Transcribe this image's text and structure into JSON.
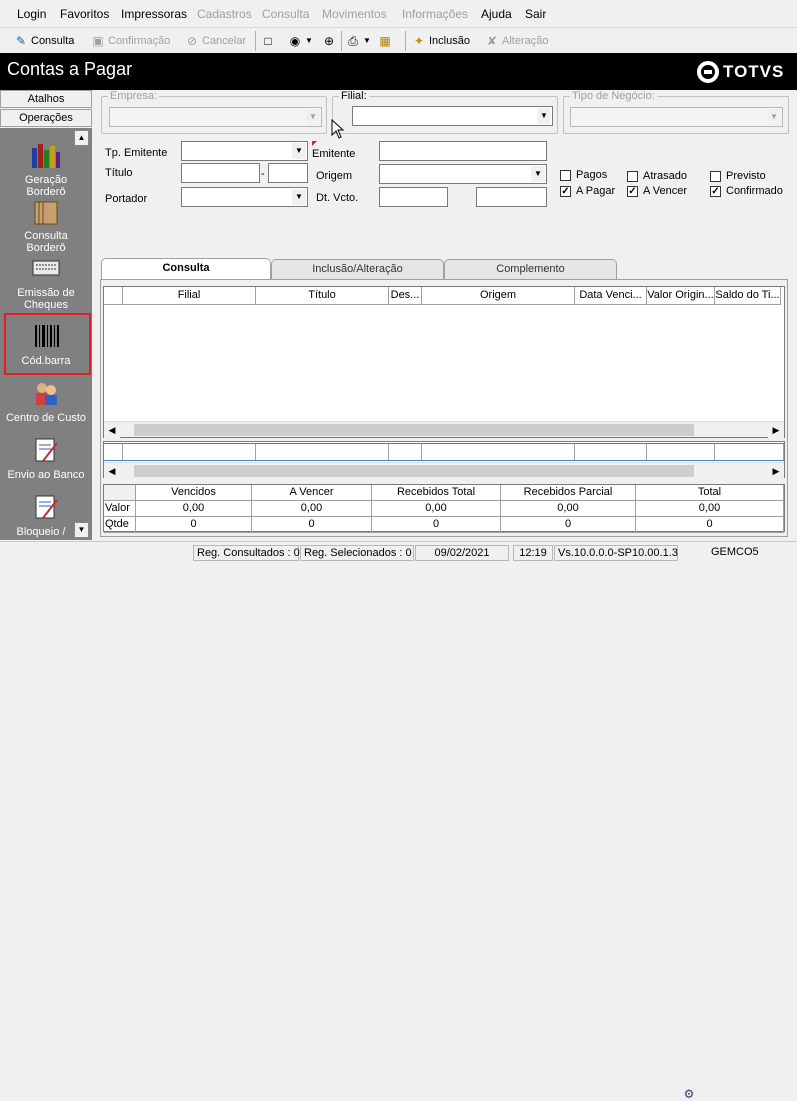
{
  "menu": [
    "Login",
    "Favoritos",
    "Impressoras",
    "Cadastros",
    "Consulta",
    "Movimentos",
    "Informações",
    "Ajuda",
    "Sair"
  ],
  "toolbar": {
    "consulta": "Consulta",
    "confirmacao": "Confirmação",
    "cancelar": "Cancelar",
    "inclusao": "Inclusão",
    "alteracao": "Alteração"
  },
  "title": "Contas a Pagar",
  "logo_text": "TOTVS",
  "sidebar": {
    "atalhos": "Atalhos",
    "operacoes": "Operações",
    "items": [
      "Geração Borderô",
      "Consulta Borderô",
      "Emissão de Cheques",
      "Cód.barra",
      "Centro de Custo",
      "Envio ao Banco",
      "Bloqueio /"
    ]
  },
  "filters": {
    "empresa": "Empresa:",
    "filial": "Filial:",
    "tipo_negocio": "Tipo de Negócio:",
    "tp_emitente": "Tp. Emitente",
    "emitente": "Emitente",
    "titulo": "Título",
    "origem": "Origem",
    "portador": "Portador",
    "dt_vcto": "Dt. Vcto.",
    "dash": "-"
  },
  "checks": [
    {
      "label": "Pagos",
      "checked": false
    },
    {
      "label": "Atrasado",
      "checked": false
    },
    {
      "label": "Previsto",
      "checked": false
    },
    {
      "label": "A Pagar",
      "checked": true
    },
    {
      "label": "A Vencer",
      "checked": true
    },
    {
      "label": "Confirmado",
      "checked": true
    }
  ],
  "tabs": [
    "Consulta",
    "Inclusão/Alteração",
    "Complemento"
  ],
  "grid_headers": [
    "Filial",
    "Título",
    "Des...",
    "Origem",
    "Data Venci...",
    "Valor Origin...",
    "Saldo do Ti..."
  ],
  "totals": {
    "headers": [
      "Vencidos",
      "A Vencer",
      "Recebidos Total",
      "Recebidos Parcial",
      "Total"
    ],
    "row_valor_label": "Valor",
    "row_qtde_label": "Qtde",
    "valor": [
      "0,00",
      "0,00",
      "0,00",
      "0,00",
      "0,00"
    ],
    "qtde": [
      "0",
      "0",
      "0",
      "0",
      "0"
    ]
  },
  "status": {
    "consultados": "Reg. Consultados : 0",
    "selecionados": "Reg. Selecionados : 0",
    "date": "09/02/2021",
    "time": "12:19",
    "version": "Vs.10.0.0.0-SP10.00.1.3",
    "user": "GEMCO5"
  }
}
